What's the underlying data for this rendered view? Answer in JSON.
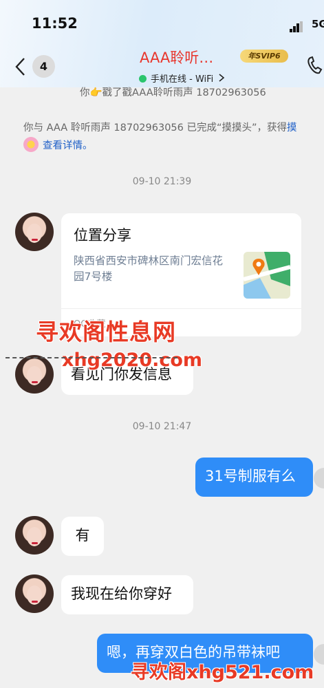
{
  "status_bar": {
    "time": "11:52",
    "network": "5G"
  },
  "header": {
    "unread_count": "4",
    "title": "AAA聆听…",
    "vip_badge": "年SVIP6",
    "online_status": "手机在线 - WiFi",
    "back_icon": "back-chevron-icon",
    "call_icon": "phone-icon"
  },
  "messages": {
    "poke_notice": "你👉戳了戳AAA聆听雨声 18702963056",
    "poke_done_notice": "你与 AAA 聆听雨声 18702963056 已完成“摸摸头”，获得",
    "poke_done_tail": "摸",
    "details_link": "查看详情。",
    "timestamp_1": "09-10 21:39",
    "location_card": {
      "title": "位置分享",
      "address": "陕西省西安市碑林区南门宏信花园7号楼",
      "footer": "QQ收藏"
    },
    "msg_see_door": "看见门你发信息",
    "timestamp_2": "09-10 21:47",
    "msg_uniform": "31号制服有么",
    "msg_yes": "有",
    "msg_dressing": "我现在给你穿好",
    "msg_stockings": "嗯，再穿双白色的吊带袜吧"
  },
  "watermarks": {
    "top_title": "寻欢阁性息网",
    "top_url": "xhg2020.com",
    "bottom": "寻欢阁xhg521.com"
  },
  "colors": {
    "accent_blue": "#2f8df8",
    "title_red": "#e8352b",
    "watermark_red": "#e83a25"
  }
}
